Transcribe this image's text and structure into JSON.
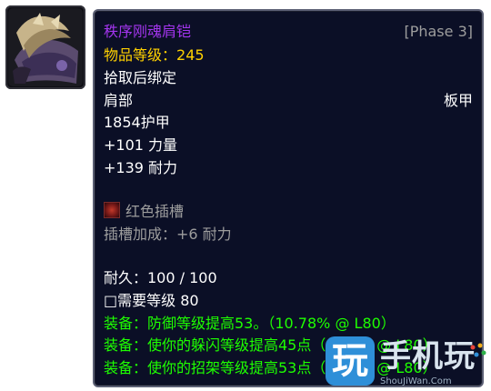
{
  "item": {
    "name": "秩序刚魂肩铠",
    "phase": "[Phase 3]",
    "item_level_label": "物品等级：",
    "item_level_value": "245",
    "bind": "拾取后绑定",
    "slot": "肩部",
    "armor_type": "板甲",
    "armor": "1854护甲",
    "stat_1": "+101 力量",
    "stat_2": "+139 耐力",
    "socket_label": "红色插槽",
    "socket_bonus": "插槽加成：+6 耐力",
    "durability": "耐久：100 / 100",
    "required_level": "□需要等级 80",
    "equip_1": "装备：防御等级提高53。（10.78% @ L80）",
    "equip_2": "装备：使你的躲闪等级提高45点（0.99% @ L80）",
    "equip_3": "装备：使你的招架等级提高53点（1.17% @ L80）",
    "icon": "shoulder-armor-icon"
  },
  "watermark": {
    "logo_glyph": "玩",
    "text": "手机玩",
    "url": "ShouJiWan.Com"
  },
  "colors": {
    "epic": "#a335ee",
    "item_level": "#ffd100",
    "grey": "#9d9d9d",
    "green": "#1eff00",
    "tooltip_bg": "#0b0f26",
    "tooltip_border": "#5b5f74"
  }
}
